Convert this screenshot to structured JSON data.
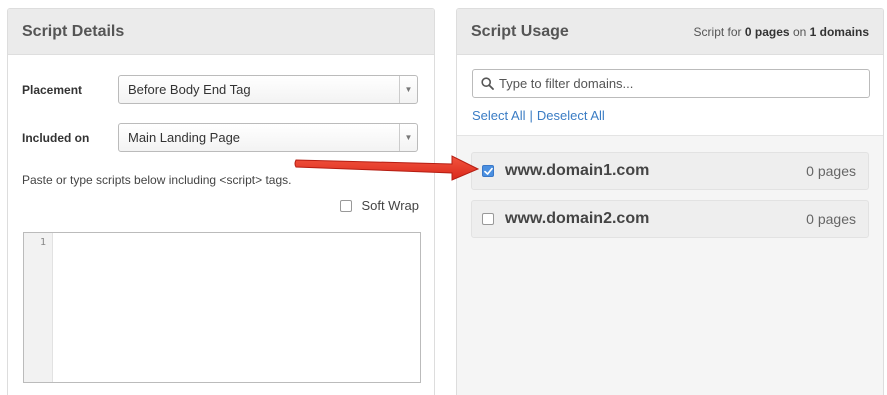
{
  "script_details": {
    "title": "Script Details",
    "placement": {
      "label": "Placement",
      "value": "Before Body End Tag"
    },
    "included_on": {
      "label": "Included on",
      "value": "Main Landing Page"
    },
    "hint": "Paste or type scripts below including <script> tags.",
    "soft_wrap": {
      "label": "Soft Wrap",
      "checked": false
    },
    "editor": {
      "line_number": "1"
    }
  },
  "script_usage": {
    "title": "Script Usage",
    "summary": {
      "prefix": "Script for",
      "pages": "0 pages",
      "middle": "on",
      "domains": "1 domains"
    },
    "filter": {
      "placeholder": "Type to filter domains..."
    },
    "select_all": "Select All",
    "separator": "|",
    "deselect_all": "Deselect All",
    "domains": [
      {
        "name": "www.domain1.com",
        "pages": "0 pages",
        "checked": true
      },
      {
        "name": "www.domain2.com",
        "pages": "0 pages",
        "checked": false
      }
    ]
  },
  "colors": {
    "accent": "#3a7cc4",
    "arrow": "#e8321f",
    "checkbox_checked": "#4a8fe0"
  }
}
